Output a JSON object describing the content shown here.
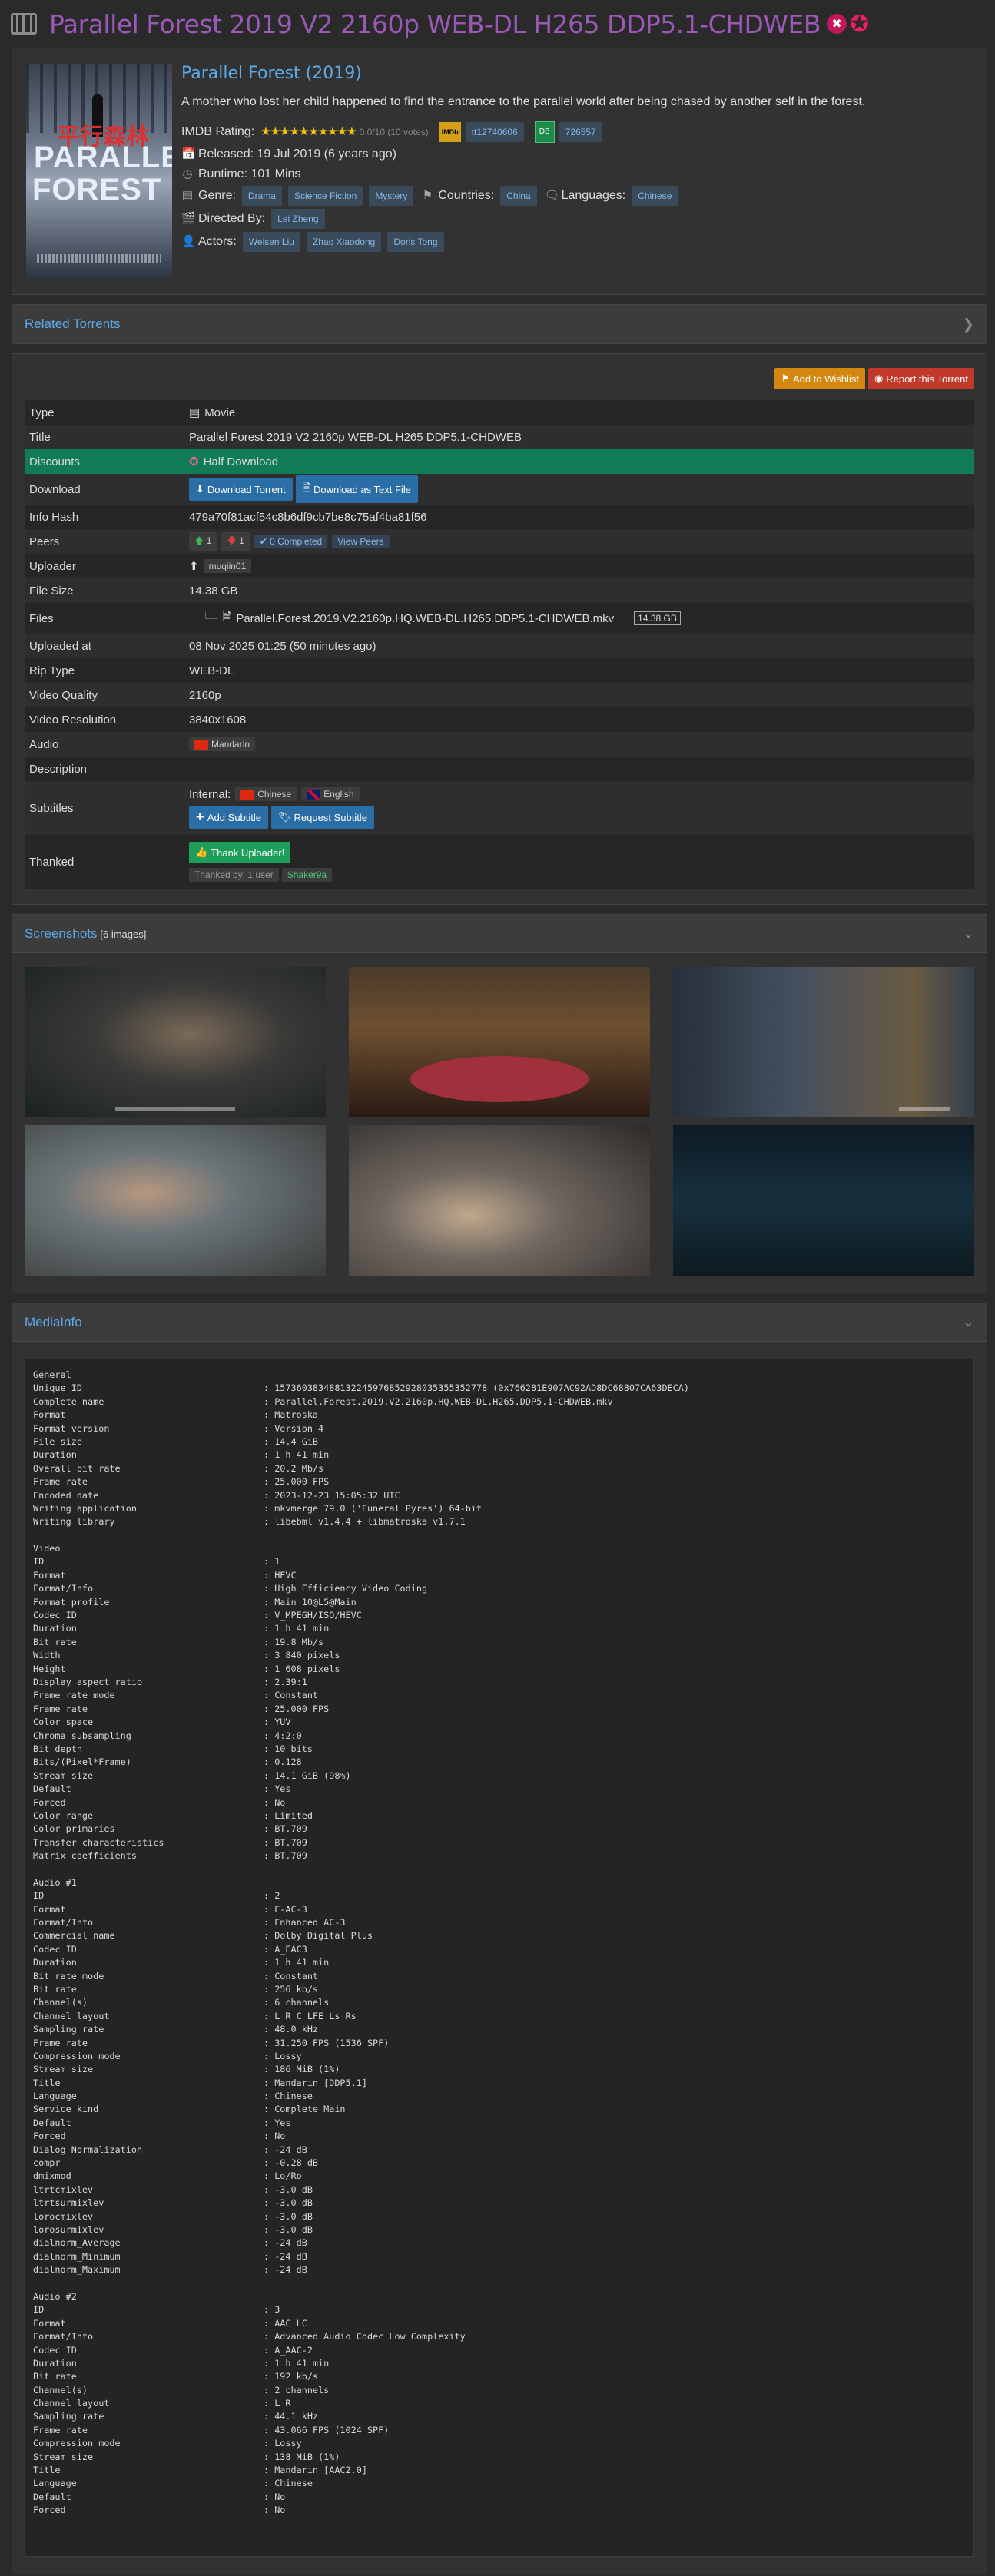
{
  "page": {
    "title": "Parallel Forest 2019 V2 2160p WEB-DL H265 DDP5.1-CHDWEB"
  },
  "movie": {
    "title": "Parallel Forest (2019)",
    "plot": "A mother who lost her child happened to find the entrance to the parallel world after being chased by another self in the forest.",
    "imdb_label": "IMDB Rating:",
    "stars": "★★★★★★★★★★",
    "rating": "0.0/10 (10 votes)",
    "imdb_badge": "IMDb",
    "imdb_id": "tt12740606",
    "db_badge": "DB",
    "db_id": "726557",
    "released": "Released: 19 Jul 2019 (6 years ago)",
    "runtime": "Runtime: 101 Mins",
    "genre_label": "Genre:",
    "genres": [
      "Drama",
      "Science Fiction",
      "Mystery"
    ],
    "countries_label": "Countries:",
    "countries": [
      "China"
    ],
    "languages_label": "Languages:",
    "languages": [
      "Chinese"
    ],
    "directed_label": "Directed By:",
    "director": "Lei Zheng",
    "actors_label": "Actors:",
    "actors": [
      "Weisen Liu",
      "Zhao Xiaodong",
      "Doris Tong"
    ],
    "poster_text_1": "PARALLEL",
    "poster_text_2": "FOREST",
    "poster_text_cn": "平行森林"
  },
  "related": {
    "title": "Related Torrents"
  },
  "actions": {
    "wishlist": "Add to Wishlist",
    "report": "Report this Torrent"
  },
  "torrent": {
    "type_k": "Type",
    "type_v": "Movie",
    "title_k": "Title",
    "title_v": "Parallel Forest 2019 V2 2160p WEB-DL H265 DDP5.1-CHDWEB",
    "discounts_k": "Discounts",
    "discounts_v": "Half Download",
    "download_k": "Download",
    "download_btn": "Download Torrent",
    "download_text_btn": "Download as Text File",
    "hash_k": "Info Hash",
    "hash_v": "479a70f81acf54c8b6df9cb7be8c75af4ba81f56",
    "peers_k": "Peers",
    "seeders": "1",
    "leechers": "1",
    "completed": "0 Completed",
    "view_peers": "View Peers",
    "uploader_k": "Uploader",
    "uploader_v": "muqiin01",
    "size_k": "File Size",
    "size_v": "14.38 GB",
    "files_k": "Files",
    "file_name": "Parallel.Forest.2019.V2.2160p.HQ.WEB-DL.H265.DDP5.1-CHDWEB.mkv",
    "file_size": "14.38 GB",
    "uploaded_k": "Uploaded at",
    "uploaded_v": "08 Nov 2025 01:25 (50 minutes ago)",
    "rip_k": "Rip Type",
    "rip_v": "WEB-DL",
    "quality_k": "Video Quality",
    "quality_v": "2160p",
    "res_k": "Video Resolution",
    "res_v": "3840x1608",
    "audio_k": "Audio",
    "audio_v": "Mandarin",
    "desc_k": "Description",
    "desc_v": "",
    "subs_k": "Subtitles",
    "subs_internal": "Internal:",
    "sub1": "Chinese",
    "sub2": "English",
    "add_sub": "Add Subtitle",
    "request_sub": "Request Subtitle",
    "thanked_k": "Thanked",
    "thank_btn": "Thank Uploader!",
    "thanked_by": "Thanked by: 1 user",
    "thanker": "Shaker9a"
  },
  "screenshots": {
    "title": "Screenshots",
    "count": "[6 images]"
  },
  "mediainfo": {
    "title": "MediaInfo",
    "lines": [
      [
        "General",
        ""
      ],
      [
        "Unique ID",
        ": 157360383488132245976852928035355352778 (0x766281E907AC92AD8DC68807CA63DECA)"
      ],
      [
        "Complete name",
        ": Parallel.Forest.2019.V2.2160p.HQ.WEB-DL.H265.DDP5.1-CHDWEB.mkv"
      ],
      [
        "Format",
        ": Matroska"
      ],
      [
        "Format version",
        ": Version 4"
      ],
      [
        "File size",
        ": 14.4 GiB"
      ],
      [
        "Duration",
        ": 1 h 41 min"
      ],
      [
        "Overall bit rate",
        ": 20.2 Mb/s"
      ],
      [
        "Frame rate",
        ": 25.000 FPS"
      ],
      [
        "Encoded date",
        ": 2023-12-23 15:05:32 UTC"
      ],
      [
        "Writing application",
        ": mkvmerge 79.0 ('Funeral Pyres') 64-bit"
      ],
      [
        "Writing library",
        ": libebml v1.4.4 + libmatroska v1.7.1"
      ],
      [
        "",
        ""
      ],
      [
        "Video",
        ""
      ],
      [
        "ID",
        ": 1"
      ],
      [
        "Format",
        ": HEVC"
      ],
      [
        "Format/Info",
        ": High Efficiency Video Coding"
      ],
      [
        "Format profile",
        ": Main 10@L5@Main"
      ],
      [
        "Codec ID",
        ": V_MPEGH/ISO/HEVC"
      ],
      [
        "Duration",
        ": 1 h 41 min"
      ],
      [
        "Bit rate",
        ": 19.8 Mb/s"
      ],
      [
        "Width",
        ": 3 840 pixels"
      ],
      [
        "Height",
        ": 1 608 pixels"
      ],
      [
        "Display aspect ratio",
        ": 2.39:1"
      ],
      [
        "Frame rate mode",
        ": Constant"
      ],
      [
        "Frame rate",
        ": 25.000 FPS"
      ],
      [
        "Color space",
        ": YUV"
      ],
      [
        "Chroma subsampling",
        ": 4:2:0"
      ],
      [
        "Bit depth",
        ": 10 bits"
      ],
      [
        "Bits/(Pixel*Frame)",
        ": 0.128"
      ],
      [
        "Stream size",
        ": 14.1 GiB (98%)"
      ],
      [
        "Default",
        ": Yes"
      ],
      [
        "Forced",
        ": No"
      ],
      [
        "Color range",
        ": Limited"
      ],
      [
        "Color primaries",
        ": BT.709"
      ],
      [
        "Transfer characteristics",
        ": BT.709"
      ],
      [
        "Matrix coefficients",
        ": BT.709"
      ],
      [
        "",
        ""
      ],
      [
        "Audio #1",
        ""
      ],
      [
        "ID",
        ": 2"
      ],
      [
        "Format",
        ": E-AC-3"
      ],
      [
        "Format/Info",
        ": Enhanced AC-3"
      ],
      [
        "Commercial name",
        ": Dolby Digital Plus"
      ],
      [
        "Codec ID",
        ": A_EAC3"
      ],
      [
        "Duration",
        ": 1 h 41 min"
      ],
      [
        "Bit rate mode",
        ": Constant"
      ],
      [
        "Bit rate",
        ": 256 kb/s"
      ],
      [
        "Channel(s)",
        ": 6 channels"
      ],
      [
        "Channel layout",
        ": L R C LFE Ls Rs"
      ],
      [
        "Sampling rate",
        ": 48.0 kHz"
      ],
      [
        "Frame rate",
        ": 31.250 FPS (1536 SPF)"
      ],
      [
        "Compression mode",
        ": Lossy"
      ],
      [
        "Stream size",
        ": 186 MiB (1%)"
      ],
      [
        "Title",
        ": Mandarin [DDP5.1]"
      ],
      [
        "Language",
        ": Chinese"
      ],
      [
        "Service kind",
        ": Complete Main"
      ],
      [
        "Default",
        ": Yes"
      ],
      [
        "Forced",
        ": No"
      ],
      [
        "Dialog Normalization",
        ": -24 dB"
      ],
      [
        "compr",
        ": -0.28 dB"
      ],
      [
        "dmixmod",
        ": Lo/Ro"
      ],
      [
        "ltrtcmixlev",
        ": -3.0 dB"
      ],
      [
        "ltrtsurmixlev",
        ": -3.0 dB"
      ],
      [
        "lorocmixlev",
        ": -3.0 dB"
      ],
      [
        "lorosurmixlev",
        ": -3.0 dB"
      ],
      [
        "dialnorm_Average",
        ": -24 dB"
      ],
      [
        "dialnorm_Minimum",
        ": -24 dB"
      ],
      [
        "dialnorm_Maximum",
        ": -24 dB"
      ],
      [
        "",
        ""
      ],
      [
        "Audio #2",
        ""
      ],
      [
        "ID",
        ": 3"
      ],
      [
        "Format",
        ": AAC LC"
      ],
      [
        "Format/Info",
        ": Advanced Audio Codec Low Complexity"
      ],
      [
        "Codec ID",
        ": A_AAC-2"
      ],
      [
        "Duration",
        ": 1 h 41 min"
      ],
      [
        "Bit rate",
        ": 192 kb/s"
      ],
      [
        "Channel(s)",
        ": 2 channels"
      ],
      [
        "Channel layout",
        ": L R"
      ],
      [
        "Sampling rate",
        ": 44.1 kHz"
      ],
      [
        "Frame rate",
        ": 43.066 FPS (1024 SPF)"
      ],
      [
        "Compression mode",
        ": Lossy"
      ],
      [
        "Stream size",
        ": 138 MiB (1%)"
      ],
      [
        "Title",
        ": Mandarin [AAC2.0]"
      ],
      [
        "Language",
        ": Chinese"
      ],
      [
        "Default",
        ": No"
      ],
      [
        "Forced",
        ": No"
      ]
    ]
  }
}
